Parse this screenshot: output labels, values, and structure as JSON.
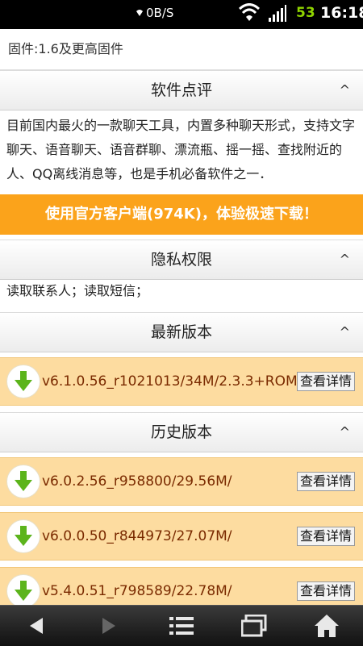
{
  "status_bar": {
    "net_speed": "0B/S",
    "battery": "53",
    "time": "16:18"
  },
  "firmware": "固件:1.6及更高固件",
  "review": {
    "title": "软件点评",
    "caret": "^",
    "text": "目前国内最火的一款聊天工具，内置多种聊天形式，支持文字聊天、语音聊天、语音群聊、漂流瓶、摇一摇、查找附近的人、QQ离线消息等，也是手机必备软件之一．"
  },
  "download_banner": "使用官方客户端(974K)，体验极速下载！",
  "privacy": {
    "title": "隐私权限",
    "caret": "^",
    "text": "读取联系人；读取短信；"
  },
  "latest": {
    "title": "最新版本",
    "caret": "^",
    "items": [
      {
        "version": "v6.1.0.56_r1021013/34M/2.3.3+ROM",
        "button": "查看详情"
      }
    ]
  },
  "history": {
    "title": "历史版本",
    "caret": "^",
    "items": [
      {
        "version": "v6.0.2.56_r958800/29.56M/",
        "button": "查看详情"
      },
      {
        "version": "v6.0.0.50_r844973/27.07M/",
        "button": "查看详情"
      },
      {
        "version": "v5.4.0.51_r798589/22.78M/",
        "button": "查看详情"
      }
    ]
  },
  "colors": {
    "banner": "#fba31b",
    "version_row": "#fddca0",
    "download_arrow": "#5cb41c"
  },
  "navbar": [
    "back-icon",
    "forward-icon",
    "menu-icon",
    "windows-icon",
    "home-icon"
  ]
}
